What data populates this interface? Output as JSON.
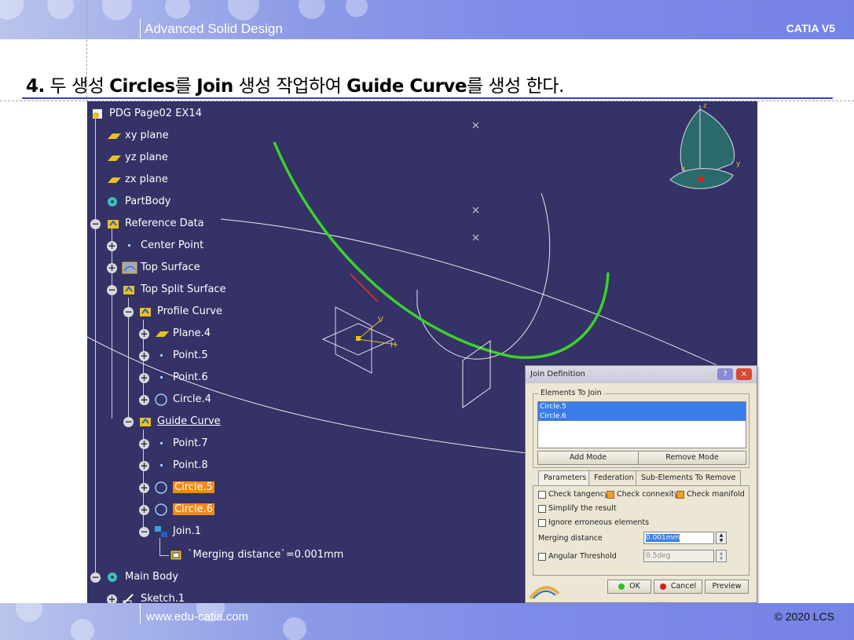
{
  "header": {
    "title": "Advanced Solid Design",
    "brand": "CATIA V5"
  },
  "heading": {
    "num": "4.",
    "p1": " 두 생성 ",
    "b1": "Circles",
    "p2": "를 ",
    "b2": "Join",
    "p3": " 생성 작업하여 ",
    "b3": "Guide Curve",
    "p4": "를 생성 한다."
  },
  "tree": {
    "items": [
      {
        "label": "PDG Page02 EX14",
        "icon": "part-icon"
      },
      {
        "label": "xy plane",
        "icon": "plane-icon"
      },
      {
        "label": "yz plane",
        "icon": "plane-icon"
      },
      {
        "label": "zx plane",
        "icon": "plane-icon"
      },
      {
        "label": "PartBody",
        "icon": "body-icon"
      },
      {
        "label": "Reference Data",
        "icon": "geoset-icon"
      },
      {
        "label": "Center Point",
        "icon": "point-icon"
      },
      {
        "label": "Top Surface",
        "icon": "surface-icon"
      },
      {
        "label": "Top Split Surface",
        "icon": "geoset-icon"
      },
      {
        "label": "Profile Curve",
        "icon": "geoset-icon"
      },
      {
        "label": "Plane.4",
        "icon": "plane-icon"
      },
      {
        "label": "Point.5",
        "icon": "point-icon"
      },
      {
        "label": "Point.6",
        "icon": "point-icon"
      },
      {
        "label": "Circle.4",
        "icon": "circle-icon"
      },
      {
        "label": "Guide Curve",
        "icon": "geoset-icon"
      },
      {
        "label": "Point.7",
        "icon": "point-icon"
      },
      {
        "label": "Point.8",
        "icon": "point-icon"
      },
      {
        "label": "Circle.5",
        "icon": "circle-icon"
      },
      {
        "label": "Circle.6",
        "icon": "circle-icon"
      },
      {
        "label": "Join.1",
        "icon": "join-icon"
      },
      {
        "label": "`Merging distance`=0.001mm",
        "icon": "parameter-icon"
      },
      {
        "label": "Main Body",
        "icon": "body-icon"
      },
      {
        "label": "Sketch.1",
        "icon": "sketch-icon"
      }
    ]
  },
  "axes": {
    "x": "x",
    "y": "y",
    "z": "z",
    "h": "H",
    "v": "V"
  },
  "dialog": {
    "title": "Join Definition",
    "help": "?",
    "close": "×",
    "elements_group": "Elements To Join",
    "elements": [
      "Circle.5",
      "Circle.6"
    ],
    "add_mode": "Add Mode",
    "remove_mode": "Remove Mode",
    "tabs": [
      "Parameters",
      "Federation",
      "Sub-Elements To Remove"
    ],
    "check_tangency": "Check tangency",
    "check_connexity": "Check connexity",
    "check_manifold": "Check manifold",
    "simplify": "Simplify the result",
    "ignore": "Ignore erroneous elements",
    "merging_label": "Merging distance",
    "merging_value": "0.001mm",
    "angular_label": "Angular Threshold",
    "angular_value": "0.5deg",
    "ok": "OK",
    "cancel": "Cancel",
    "preview": "Preview"
  },
  "footer": {
    "url": "www.edu-catia.com",
    "copyright": "© 2020 LCS"
  },
  "colors": {
    "viewport_bg": "#343266",
    "green_curve": "#3cd22a",
    "highlight": "#f08a1a",
    "selection": "#3a7de8"
  }
}
